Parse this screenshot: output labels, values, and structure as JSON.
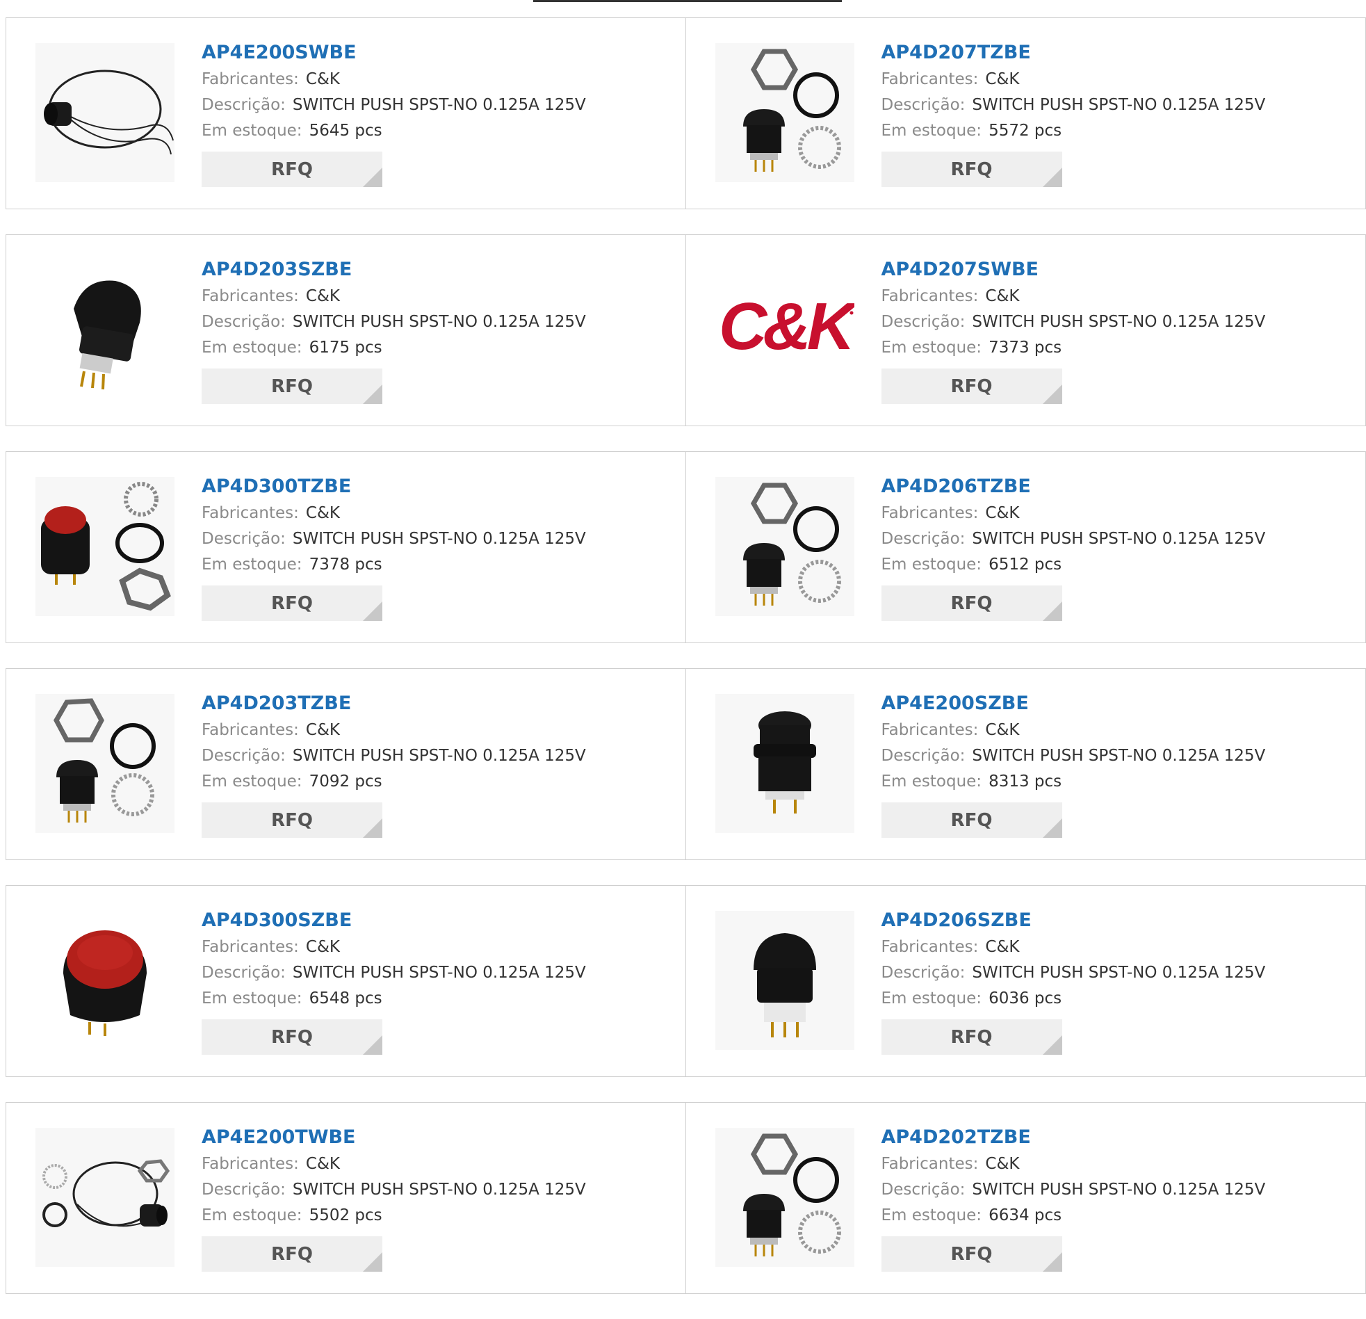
{
  "labels": {
    "manufacturer": "Fabricantes:",
    "description": "Descrição:",
    "stock": "Em estoque:",
    "rfq": "RFQ"
  },
  "products": [
    {
      "pn": "AP4E200SWBE",
      "mfr": "C&K",
      "desc": "SWITCH PUSH SPST-NO 0.125A 125V",
      "stock": "5645 pcs",
      "image": "wire-lead-switch"
    },
    {
      "pn": "AP4D207TZBE",
      "mfr": "C&K",
      "desc": "SWITCH PUSH SPST-NO 0.125A 125V",
      "stock": "5572 pcs",
      "image": "switch-with-hardware"
    },
    {
      "pn": "AP4D203SZBE",
      "mfr": "C&K",
      "desc": "SWITCH PUSH SPST-NO 0.125A 125V",
      "stock": "6175 pcs",
      "image": "black-switch-angled"
    },
    {
      "pn": "AP4D207SWBE",
      "mfr": "C&K",
      "desc": "SWITCH PUSH SPST-NO 0.125A 125V",
      "stock": "7373 pcs",
      "image": "ck-logo"
    },
    {
      "pn": "AP4D300TZBE",
      "mfr": "C&K",
      "desc": "SWITCH PUSH SPST-NO 0.125A 125V",
      "stock": "7378 pcs",
      "image": "red-switch-with-hardware"
    },
    {
      "pn": "AP4D206TZBE",
      "mfr": "C&K",
      "desc": "SWITCH PUSH SPST-NO 0.125A 125V",
      "stock": "6512 pcs",
      "image": "switch-with-hardware"
    },
    {
      "pn": "AP4D203TZBE",
      "mfr": "C&K",
      "desc": "SWITCH PUSH SPST-NO 0.125A 125V",
      "stock": "7092 pcs",
      "image": "switch-with-hardware"
    },
    {
      "pn": "AP4E200SZBE",
      "mfr": "C&K",
      "desc": "SWITCH PUSH SPST-NO 0.125A 125V",
      "stock": "8313 pcs",
      "image": "black-switch"
    },
    {
      "pn": "AP4D300SZBE",
      "mfr": "C&K",
      "desc": "SWITCH PUSH SPST-NO 0.125A 125V",
      "stock": "6548 pcs",
      "image": "red-switch"
    },
    {
      "pn": "AP4D206SZBE",
      "mfr": "C&K",
      "desc": "SWITCH PUSH SPST-NO 0.125A 125V",
      "stock": "6036 pcs",
      "image": "black-switch-white-base"
    },
    {
      "pn": "AP4E200TWBE",
      "mfr": "C&K",
      "desc": "SWITCH PUSH SPST-NO 0.125A 125V",
      "stock": "5502 pcs",
      "image": "wire-lead-switch-hardware"
    },
    {
      "pn": "AP4D202TZBE",
      "mfr": "C&K",
      "desc": "SWITCH PUSH SPST-NO 0.125A 125V",
      "stock": "6634 pcs",
      "image": "switch-with-hardware"
    }
  ],
  "colors": {
    "link": "#1f6fb5",
    "label": "#8a8a8a",
    "rfq_bg": "#efefef",
    "logo_red": "#c8102e"
  }
}
